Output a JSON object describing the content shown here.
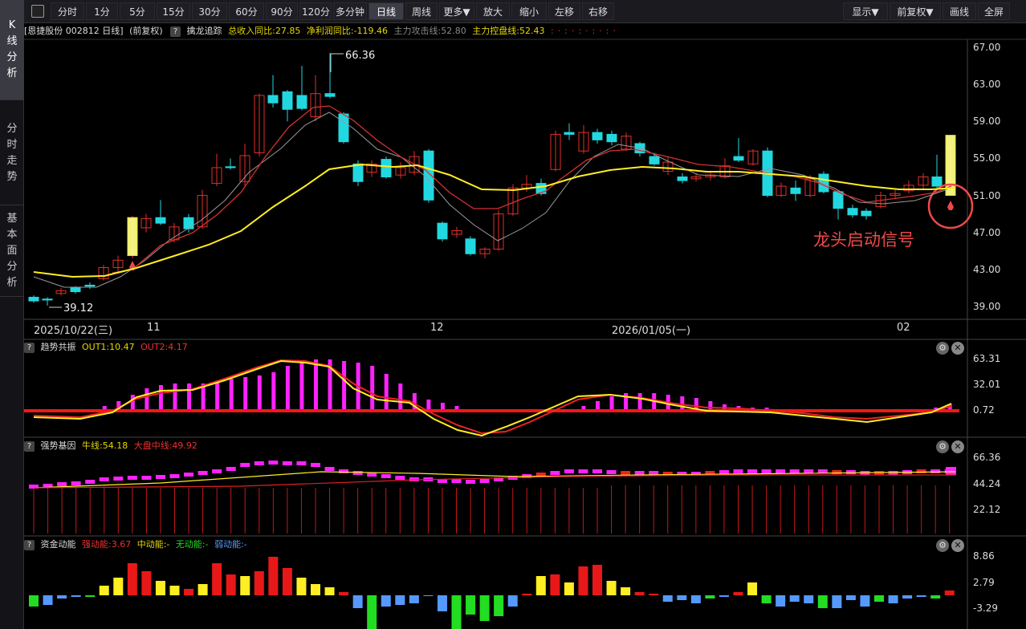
{
  "sidebar": {
    "tabs": [
      {
        "label": [
          "K",
          "线",
          "分",
          "析"
        ],
        "active": true
      },
      {
        "label": [
          "分",
          "时",
          "走",
          "势"
        ],
        "active": false
      },
      {
        "label": [
          "基",
          "本",
          "面",
          "分",
          "析"
        ],
        "active": false
      }
    ]
  },
  "toolbar": {
    "periods": [
      "分时",
      "1分",
      "5分",
      "15分",
      "30分",
      "60分",
      "90分",
      "120分",
      "多分钟",
      "日线",
      "周线",
      "更多▼"
    ],
    "active_period": "日线",
    "actions": [
      "放大",
      "缩小",
      "左移",
      "右移"
    ],
    "right": [
      "显示▼",
      "前复权▼",
      "画线",
      "全屏"
    ]
  },
  "info": {
    "stock": "[恩捷股份 002812 日线]",
    "adjust": "(前复权)",
    "indicator": "擒龙追踪",
    "revenue": "总收入同比:27.85",
    "profit": "净利润同比:-119.46",
    "attack": "主力攻击线:52.80",
    "control": "主力控盘线:52.43"
  },
  "main_chart": {
    "price_labels": [
      "67.00",
      "63.00",
      "59.00",
      "55.00",
      "51.00",
      "47.00",
      "43.00",
      "39.00"
    ],
    "high_label": "66.36",
    "low_label": "39.12",
    "dates": [
      "2025/10/22(三)",
      "11",
      "12",
      "2026/01/05(一)",
      "02"
    ],
    "annotation": "龙头启动信号"
  },
  "panel1": {
    "name": "趋势共振",
    "out1": "OUT1:10.47",
    "out2": "OUT2:4.17",
    "axis": [
      "63.31",
      "32.01",
      "0.72"
    ]
  },
  "panel2": {
    "name": "强势基因",
    "bull": "牛线:54.18",
    "market": "大盘中线:49.92",
    "axis": [
      "66.36",
      "44.24",
      "22.12"
    ]
  },
  "panel3": {
    "name": "资金动能",
    "strong": "强动能:3.67",
    "mid": "中动能:-",
    "none": "无动能:-",
    "weak": "弱动能:-",
    "axis": [
      "8.86",
      "2.79",
      "-3.29"
    ]
  },
  "colors": {
    "up": "#e0302a",
    "down": "#22d8e0",
    "ma_yellow": "#ffee22",
    "magenta": "#ff22ff"
  }
}
